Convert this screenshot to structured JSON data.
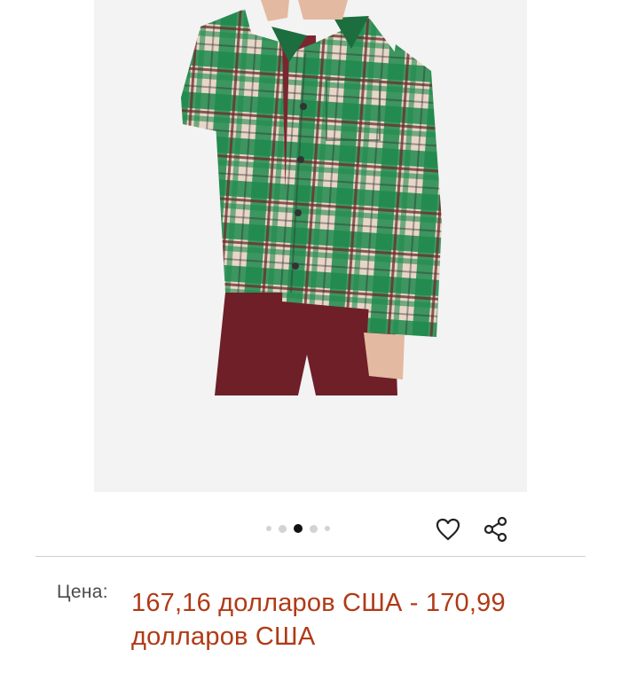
{
  "product": {
    "image_alt": "Green plaid overshirt jacket on model",
    "carousel": {
      "total": 5,
      "active_index": 2
    },
    "actions": {
      "favorite_icon": "heart-icon",
      "share_icon": "share-icon"
    },
    "price": {
      "label": "Цена:",
      "value": "167,16 долларов США - 170,99 долларов США"
    }
  },
  "colors": {
    "price": "#b03a16",
    "background": "#f3f3f3",
    "plaid_green": "#1f8a4c",
    "shorts": "#6e1f27"
  }
}
